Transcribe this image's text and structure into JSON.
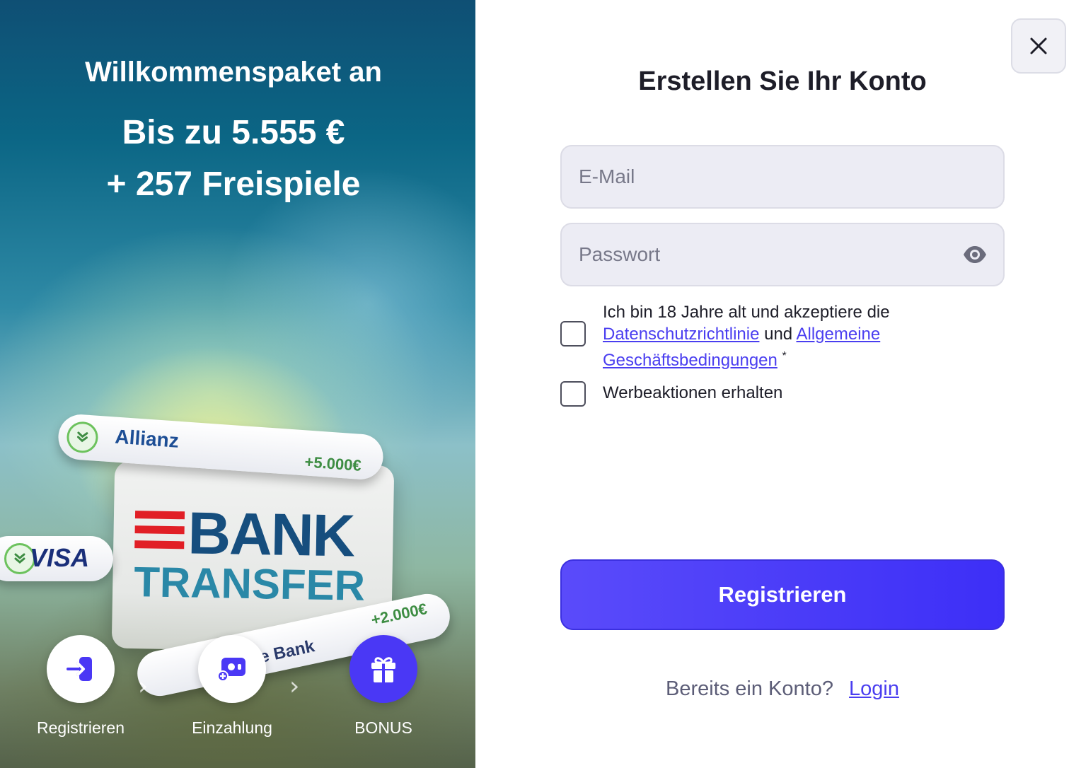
{
  "promo": {
    "line1": "Willkommenspaket an",
    "line2": "Bis zu 5.555 €",
    "line3": "+ 257 Freispiele",
    "art": {
      "allianz_brand": "Allianz",
      "allianz_amount": "+5.000€",
      "visa_brand": "VISA",
      "bank_word": "BANK",
      "bank_word2": "TRANSFER",
      "bank_pill_brand": "he Bank",
      "bank_pill_amount": "+2.000€"
    },
    "steps": [
      {
        "label": "Registrieren",
        "icon": "login-arrow-icon"
      },
      {
        "label": "Einzahlung",
        "icon": "deposit-card-icon"
      },
      {
        "label": "BONUS",
        "icon": "gift-icon"
      }
    ]
  },
  "form": {
    "title": "Erstellen Sie Ihr Konto",
    "email_placeholder": "E-Mail",
    "password_placeholder": "Passwort",
    "terms_prefix": "Ich bin 18 Jahre alt und akzeptiere die",
    "privacy_link": "Datenschutzrichtlinie",
    "terms_and": "und",
    "terms_link": "Allgemeine Geschäftsbedingungen",
    "required_mark": "*",
    "promo_label": "Werbeaktionen erhalten",
    "submit_label": "Registrieren",
    "login_prompt": "Bereits ein Konto?",
    "login_link": "Login"
  },
  "colors": {
    "accent": "#4a38f5",
    "link": "#4a3ef0"
  }
}
